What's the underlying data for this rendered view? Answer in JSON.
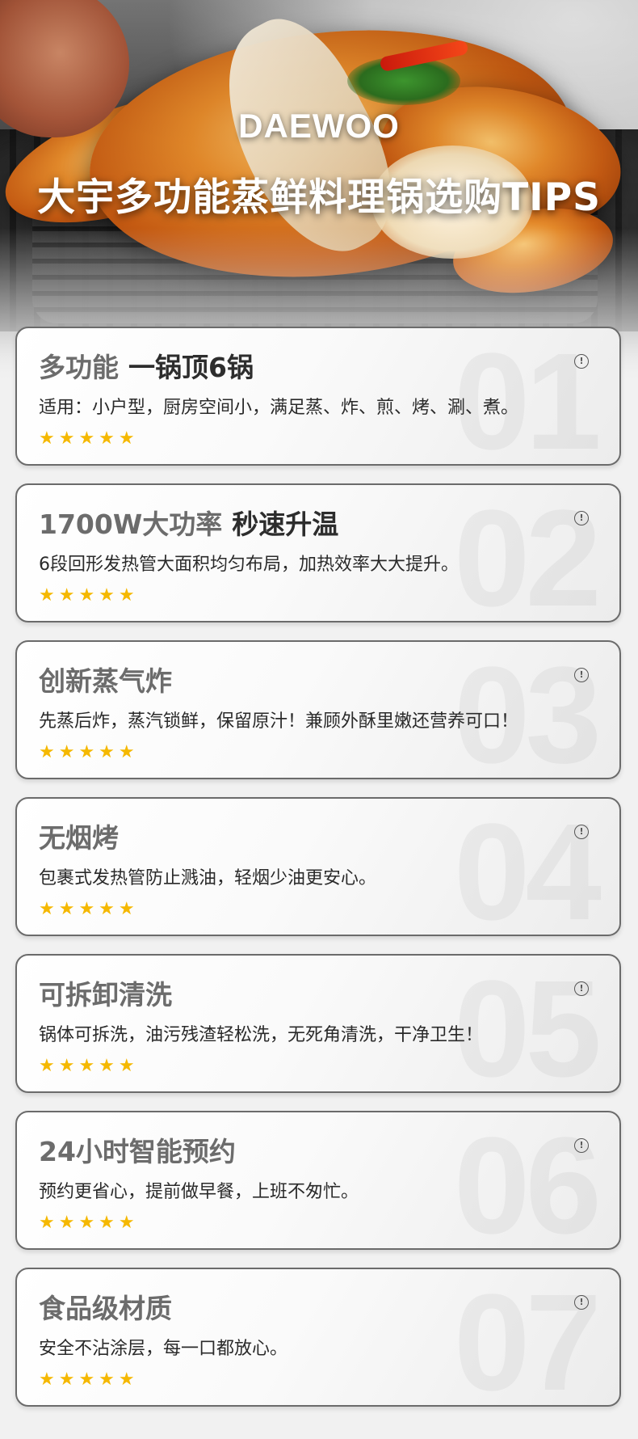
{
  "hero": {
    "logo": "DAEWOO",
    "headline": "大宇多功能蒸鲜料理锅选购TIPS"
  },
  "colors": {
    "star": "#f5b800",
    "card_border": "#6b6b6b",
    "title_grey": "#6c6c6c",
    "title_dark": "#2d2d2d"
  },
  "icons": {
    "info": "info-circle-icon",
    "star": "star-icon"
  },
  "cards": [
    {
      "num": "01",
      "title_a": "多功能",
      "title_b": "一锅顶6锅",
      "desc": "适用：小户型，厨房空间小，满足蒸、炸、煎、烤、涮、煮。",
      "stars": "★★★★★",
      "rating": 5
    },
    {
      "num": "02",
      "title_a": "1700W大功率",
      "title_b": "秒速升温",
      "desc": "6段回形发热管大面积均匀布局，加热效率大大提升。",
      "stars": "★★★★★",
      "rating": 5
    },
    {
      "num": "03",
      "title_a": "创新蒸气炸",
      "title_b": "",
      "desc": "先蒸后炸，蒸汽锁鲜，保留原汁！兼顾外酥里嫩还营养可口！",
      "stars": "★★★★★",
      "rating": 5
    },
    {
      "num": "04",
      "title_a": "无烟烤",
      "title_b": "",
      "desc": "包裹式发热管防止溅油，轻烟少油更安心。",
      "stars": "★★★★★",
      "rating": 5
    },
    {
      "num": "05",
      "title_a": "可拆卸清洗",
      "title_b": "",
      "desc": "锅体可拆洗，油污残渣轻松洗，无死角清洗，干净卫生！",
      "stars": "★★★★★",
      "rating": 5
    },
    {
      "num": "06",
      "title_a": "24小时智能预约",
      "title_b": "",
      "desc": "预约更省心，提前做早餐，上班不匆忙。",
      "stars": "★★★★★",
      "rating": 5
    },
    {
      "num": "07",
      "title_a": "食品级材质",
      "title_b": "",
      "desc": "安全不沾涂层，每一口都放心。",
      "stars": "★★★★★",
      "rating": 5
    }
  ]
}
